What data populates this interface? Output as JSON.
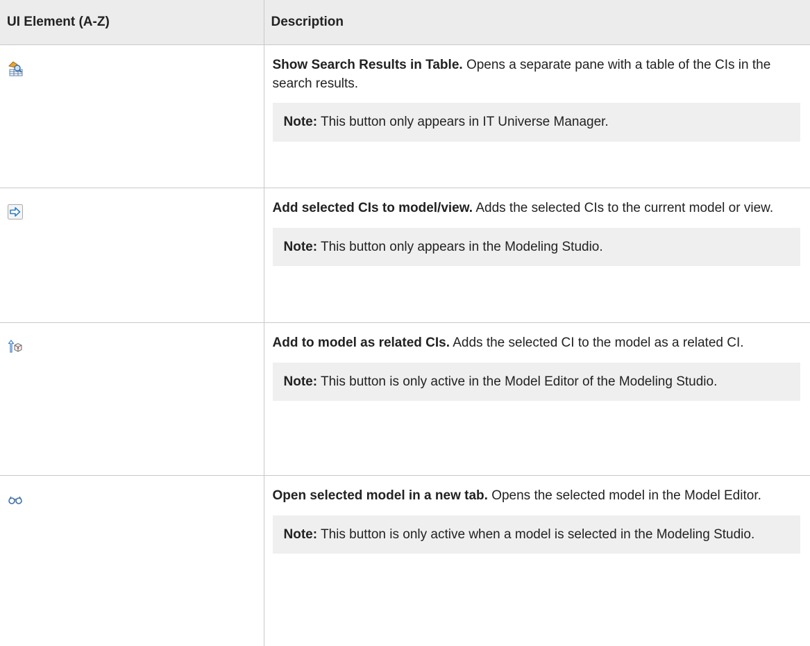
{
  "header": {
    "col1": "UI Element (A-Z)",
    "col2": "Description"
  },
  "rows": [
    {
      "icon": "search-table-icon",
      "title": "Show Search Results in Table.",
      "text": "Opens a separate pane with a table of the CIs in the search results.",
      "note_label": "Note:",
      "note_text": "This button only appears in IT Universe Manager."
    },
    {
      "icon": "arrow-right-icon",
      "title": "Add selected CIs to model/view.",
      "text": "Adds the selected CIs to the current model or view.",
      "note_label": "Note:",
      "note_text": "This button only appears in the Modeling Studio."
    },
    {
      "icon": "add-related-cis-icon",
      "title": "Add to model as related CIs.",
      "text": "Adds the selected CI to the model as a related CI.",
      "note_label": "Note:",
      "note_text": "This button is only active in the Model Editor of the Modeling Studio."
    },
    {
      "icon": "glasses-icon",
      "title": "Open selected model in a new tab.",
      "text": "Opens the selected model in the Model Editor.",
      "note_label": "Note:",
      "note_text": "This button is only active when a model is selected in the Modeling Studio."
    }
  ]
}
